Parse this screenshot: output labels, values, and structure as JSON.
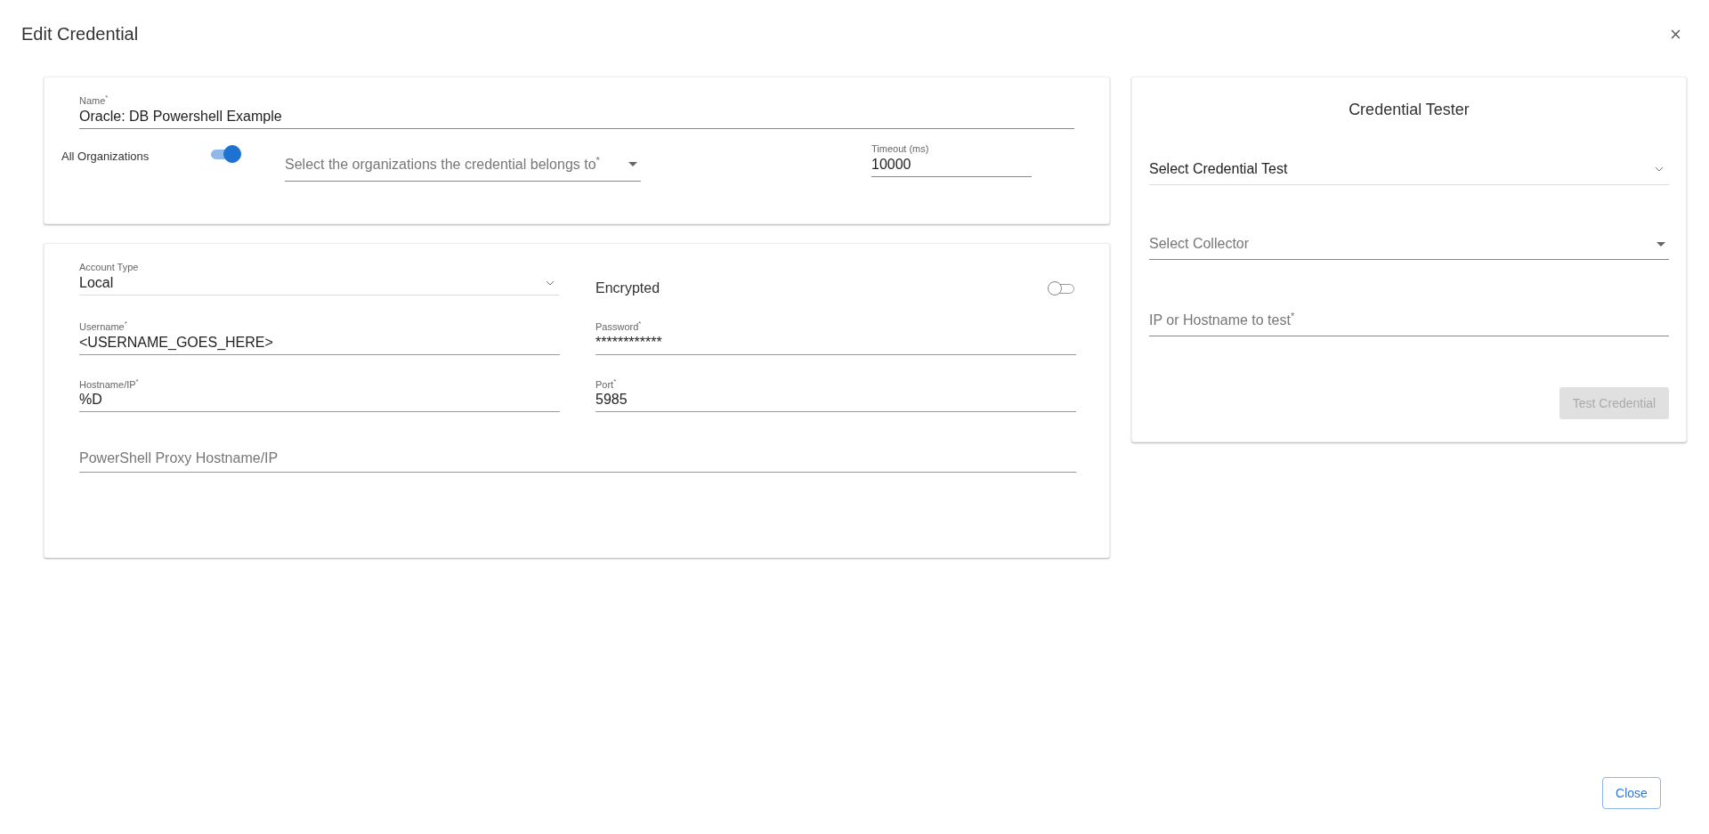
{
  "dialog": {
    "title": "Edit Credential"
  },
  "general": {
    "name": {
      "label": "Name$^{*}$",
      "value": "Oracle: DB Powershell Example"
    },
    "all_organizations": {
      "label": "All Organizations",
      "on": true
    },
    "organizations": {
      "placeholder": "Select the organizations the credential belongs to$^{*}$"
    },
    "timeout": {
      "label": "Timeout (ms)",
      "value": "10000"
    }
  },
  "connection": {
    "fields": [
      {
        "kind": "select",
        "label": "Account Type",
        "value": "Local"
      },
      {
        "kind": "toggle",
        "label": "Encrypted",
        "on": false
      },
      {
        "kind": "text",
        "label": "Username$^{*}$",
        "value": "<USERNAME_GOES_HERE>"
      },
      {
        "kind": "text",
        "label": "Password$^{*}$",
        "value": "************"
      },
      {
        "kind": "text",
        "label": "Hostname/IP$^{*}$",
        "value": "%D"
      },
      {
        "kind": "text",
        "label": "Port$^{*}$",
        "value": "5985"
      },
      {
        "kind": "empty",
        "placeholder": "PowerShell Proxy Hostname/IP"
      }
    ]
  },
  "tester": {
    "title": "Credential Tester",
    "fields": [
      {
        "kind": "select",
        "value": "Select Credential Test"
      },
      {
        "kind": "dropdown",
        "placeholder": "Select Collector"
      },
      {
        "kind": "empty",
        "placeholder": "IP or Hostname to test$^{*}$"
      }
    ],
    "button": {
      "label": "Test Credential",
      "disabled": true
    }
  },
  "footer": {
    "close": "Close"
  }
}
